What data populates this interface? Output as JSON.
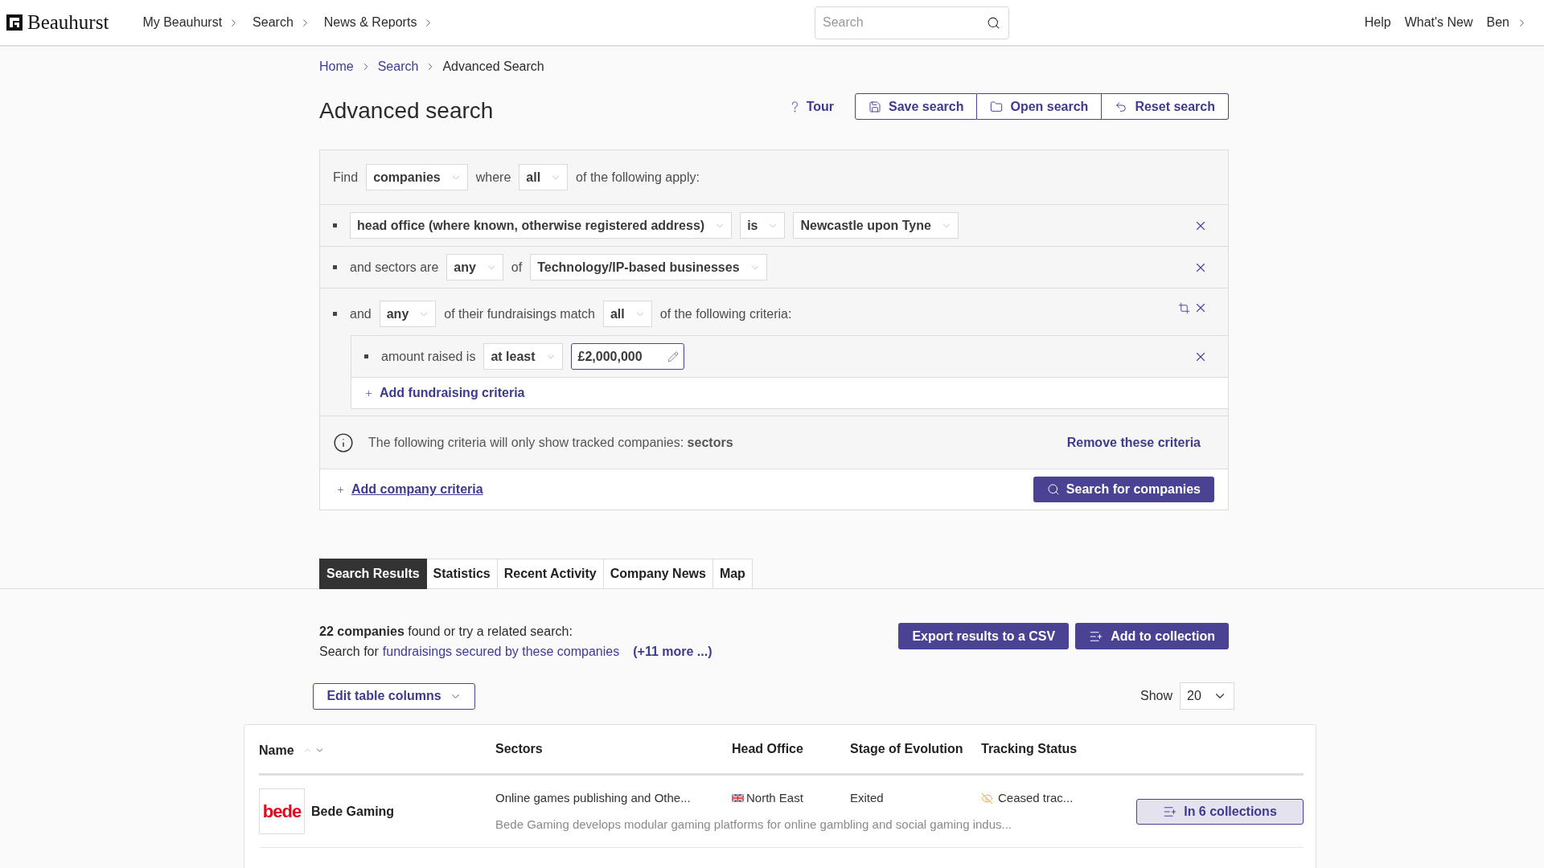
{
  "header": {
    "brand": "Beauhurst",
    "nav": [
      "My Beauhurst",
      "Search",
      "News & Reports"
    ],
    "search": {
      "placeholder": "Search"
    },
    "links": [
      {
        "label": "Help",
        "menu": false
      },
      {
        "label": "What's New",
        "menu": false
      },
      {
        "label": "Ben",
        "menu": true
      }
    ]
  },
  "breadcrumb": [
    {
      "label": "Home",
      "current": false
    },
    {
      "label": "Search",
      "current": false
    },
    {
      "label": "Advanced Search",
      "current": true
    }
  ],
  "page": {
    "title": "Advanced search",
    "tour": "Tour",
    "actions": [
      "Save search",
      "Open search",
      "Reset search"
    ]
  },
  "query": {
    "find": [
      {
        "kind": "text",
        "value": "Find"
      },
      {
        "kind": "select",
        "value": "companies"
      },
      {
        "kind": "text",
        "value": "where"
      },
      {
        "kind": "select",
        "value": "all"
      },
      {
        "kind": "text",
        "value": "of the following apply:"
      }
    ],
    "criteria": [
      {
        "kind": "field",
        "parts": [
          {
            "kind": "select",
            "value": "head office (where known, otherwise registered address)"
          },
          {
            "kind": "select",
            "value": "is"
          },
          {
            "kind": "select",
            "value": "Newcastle upon Tyne"
          }
        ]
      },
      {
        "kind": "field",
        "parts": [
          {
            "kind": "text",
            "value": "and sectors are"
          },
          {
            "kind": "select",
            "value": "any"
          },
          {
            "kind": "text",
            "value": "of"
          },
          {
            "kind": "select",
            "value": "Technology/IP-based businesses"
          }
        ]
      },
      {
        "kind": "group",
        "parts": [
          {
            "kind": "text",
            "value": "and"
          },
          {
            "kind": "select",
            "value": "any"
          },
          {
            "kind": "text",
            "value": "of their fundraisings match"
          },
          {
            "kind": "select",
            "value": "all"
          },
          {
            "kind": "text",
            "value": "of the following criteria:"
          }
        ],
        "children": [
          {
            "kind": "field",
            "parts": [
              {
                "kind": "text",
                "value": "amount raised is"
              },
              {
                "kind": "select",
                "value": "at least"
              },
              {
                "kind": "input",
                "value": "£2,000,000"
              }
            ]
          }
        ],
        "add": "Add fundraising criteria"
      }
    ],
    "notice": {
      "text": "The following criteria will only show tracked companies: **sectors**",
      "action": "Remove these criteria"
    },
    "add": "Add company criteria",
    "submit": "Search for companies"
  },
  "tabs": [
    {
      "label": "Search Results",
      "selected": true
    },
    {
      "label": "Statistics",
      "selected": false
    },
    {
      "label": "Recent Activity",
      "selected": false
    },
    {
      "label": "Company News",
      "selected": false
    },
    {
      "label": "Map",
      "selected": false
    }
  ],
  "results": {
    "summary": "**22 companies** found or try a related search:",
    "related_label": "Search for",
    "related_link": "fundraisings secured by these companies",
    "more": "(+11 more ...)",
    "actions": [
      {
        "kind": "export",
        "label": "Export results to a CSV"
      },
      {
        "kind": "collection",
        "label": "Add to collection"
      }
    ],
    "edit_columns": "Edit table columns",
    "show_label": "Show",
    "page_size": "20"
  },
  "table": {
    "columns": [
      "Name",
      "Sectors",
      "Head Office",
      "Stage of Evolution",
      "Tracking Status"
    ],
    "rows": [
      {
        "logo": "bede",
        "name": "Bede Gaming",
        "sectors": "Online games publishing and Othe...",
        "head_office": "North East",
        "stage": "Exited",
        "tracking": "Ceased trac...",
        "description": "Bede Gaming develops modular gaming platforms for online gambling and social gaming indus...",
        "collections": "In 6 collections"
      }
    ]
  }
}
